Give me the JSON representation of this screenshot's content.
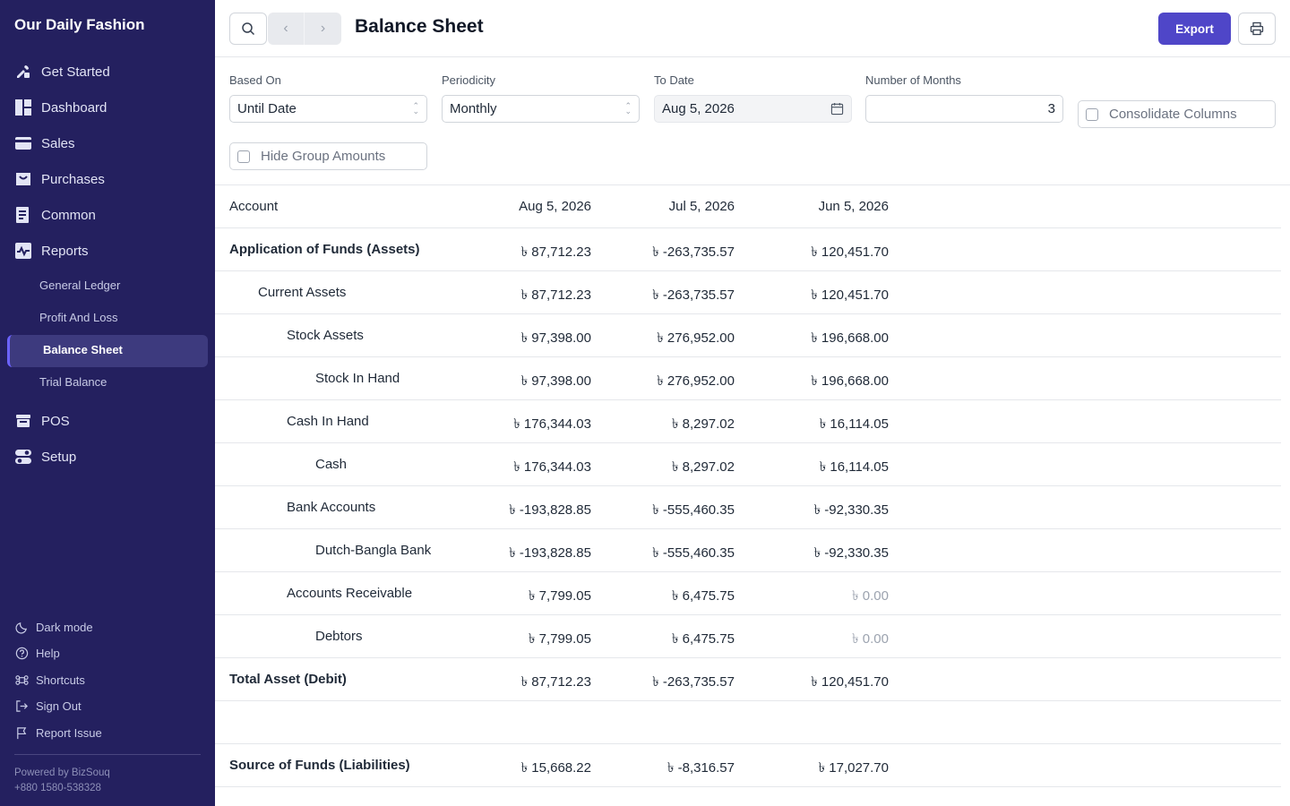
{
  "sidebar": {
    "brand": "Our Daily Fashion",
    "nav": [
      {
        "label": "Get Started",
        "icon": "tools-icon"
      },
      {
        "label": "Dashboard",
        "icon": "dashboard-icon"
      },
      {
        "label": "Sales",
        "icon": "sales-icon"
      },
      {
        "label": "Purchases",
        "icon": "purchases-icon"
      },
      {
        "label": "Common",
        "icon": "common-icon"
      },
      {
        "label": "Reports",
        "icon": "reports-icon"
      }
    ],
    "report_items": [
      "General Ledger",
      "Profit And Loss",
      "Balance Sheet",
      "Trial Balance"
    ],
    "nav_after": [
      {
        "label": "POS",
        "icon": "pos-icon"
      },
      {
        "label": "Setup",
        "icon": "setup-icon"
      }
    ],
    "footer": [
      {
        "label": "Dark mode",
        "icon": "moon-icon"
      },
      {
        "label": "Help",
        "icon": "help-icon"
      },
      {
        "label": "Shortcuts",
        "icon": "command-icon"
      },
      {
        "label": "Sign Out",
        "icon": "sign-out-icon"
      },
      {
        "label": "Report Issue",
        "icon": "flag-icon"
      }
    ],
    "powered_by": "Powered by BizSouq",
    "phone": "+880 1580-538328"
  },
  "topbar": {
    "title": "Balance Sheet",
    "export_label": "Export"
  },
  "filters": {
    "based_on": {
      "label": "Based On",
      "value": "Until Date"
    },
    "periodicity": {
      "label": "Periodicity",
      "value": "Monthly"
    },
    "to_date": {
      "label": "To Date",
      "value": "Aug 5, 2026"
    },
    "months": {
      "label": "Number of Months",
      "value": "3"
    },
    "consolidate": "Consolidate Columns",
    "hide_group": "Hide Group Amounts"
  },
  "table": {
    "headers": [
      "Account",
      "Aug 5, 2026",
      "Jul 5, 2026",
      "Jun 5, 2026"
    ],
    "rows": [
      {
        "account": "Application of Funds (Assets)",
        "indent": 0,
        "bold": true,
        "values": [
          "৳ 87,712.23",
          "৳ -263,735.57",
          "৳ 120,451.70"
        ]
      },
      {
        "account": "Current Assets",
        "indent": 1,
        "bold": false,
        "values": [
          "৳ 87,712.23",
          "৳ -263,735.57",
          "৳ 120,451.70"
        ]
      },
      {
        "account": "Stock Assets",
        "indent": 2,
        "bold": false,
        "values": [
          "৳ 97,398.00",
          "৳ 276,952.00",
          "৳ 196,668.00"
        ]
      },
      {
        "account": "Stock In Hand",
        "indent": 3,
        "bold": false,
        "values": [
          "৳ 97,398.00",
          "৳ 276,952.00",
          "৳ 196,668.00"
        ]
      },
      {
        "account": "Cash In Hand",
        "indent": 2,
        "bold": false,
        "values": [
          "৳ 176,344.03",
          "৳ 8,297.02",
          "৳ 16,114.05"
        ]
      },
      {
        "account": "Cash",
        "indent": 3,
        "bold": false,
        "values": [
          "৳ 176,344.03",
          "৳ 8,297.02",
          "৳ 16,114.05"
        ]
      },
      {
        "account": "Bank Accounts",
        "indent": 2,
        "bold": false,
        "values": [
          "৳ -193,828.85",
          "৳ -555,460.35",
          "৳ -92,330.35"
        ]
      },
      {
        "account": "Dutch-Bangla Bank",
        "indent": 3,
        "bold": false,
        "values": [
          "৳ -193,828.85",
          "৳ -555,460.35",
          "৳ -92,330.35"
        ]
      },
      {
        "account": "Accounts Receivable",
        "indent": 2,
        "bold": false,
        "values": [
          "৳ 7,799.05",
          "৳ 6,475.75",
          "৳ 0.00"
        ]
      },
      {
        "account": "Debtors",
        "indent": 3,
        "bold": false,
        "values": [
          "৳ 7,799.05",
          "৳ 6,475.75",
          "৳ 0.00"
        ]
      },
      {
        "account": "Total Asset (Debit)",
        "indent": 0,
        "bold": true,
        "values": [
          "৳ 87,712.23",
          "৳ -263,735.57",
          "৳ 120,451.70"
        ]
      },
      {
        "account": "",
        "indent": 0,
        "bold": false,
        "values": [
          "",
          "",
          ""
        ]
      },
      {
        "account": "Source of Funds (Liabilities)",
        "indent": 0,
        "bold": true,
        "values": [
          "৳ 15,668.22",
          "৳ -8,316.57",
          "৳ 17,027.70"
        ]
      }
    ]
  },
  "colors": {
    "sidebar_bg": "#24205f",
    "accent": "#4f46c8"
  }
}
